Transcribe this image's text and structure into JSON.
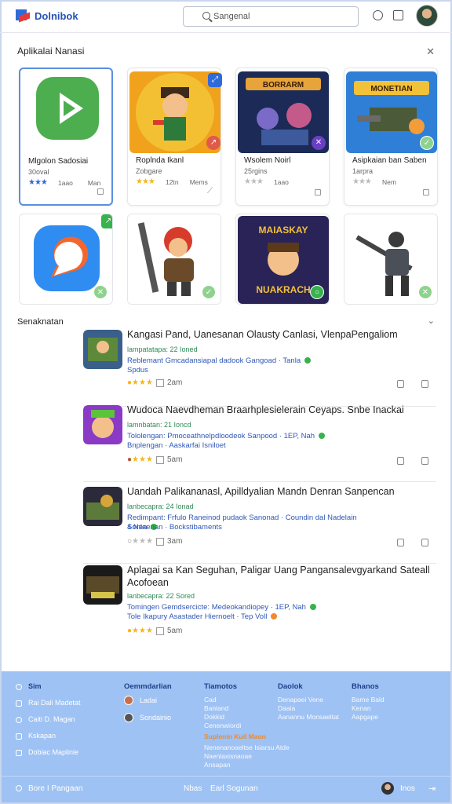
{
  "header": {
    "app_name": "Dolnibok",
    "search_placeholder": "Sangenal"
  },
  "featured": {
    "title": "Aplikalai Nanasi",
    "cards": [
      {
        "title": "Mlgolon Sadosiai",
        "subtitle": "30oval",
        "meta": "1aao",
        "meta2": "Man",
        "stars": "★★★"
      },
      {
        "title": "Roplnda Ikanl",
        "subtitle": "Zobgare",
        "meta": "12tn",
        "meta2": "Mems",
        "stars": "★★★"
      },
      {
        "title": "Wsolem Noirl",
        "subtitle": "25rgins",
        "meta": "1aao",
        "meta2": "",
        "stars": "★★★"
      },
      {
        "title": "Asipkaian ban Saben",
        "subtitle": "1arpra",
        "meta": "Nem",
        "meta2": "",
        "stars": "★★★"
      }
    ],
    "thumb_texts": [
      "BORRARM",
      "MONETIAN",
      "MAIASKAY",
      "NUAKRACH"
    ]
  },
  "recommend": {
    "title": "Senaknatan",
    "rows": [
      {
        "title": "Kangasi Pand, Uanesanan Olausty Canlasi, VlenpaPengaliom",
        "meta": "lampatatapa: 22 Ioned",
        "desc1": "Reblemant Gmcadansiapal dadook Gangoad · Tanla",
        "desc2": "Spdus",
        "time": "2am"
      },
      {
        "title": "Wudoca Naevdheman Braarhplesielerain Ceyaps. Snbe Inackai",
        "meta": "lamnbatan: 21 Ioncd",
        "desc1": "Tololengan: Pmoceathnelpdloodeok Sanpood · 1EP, Nah",
        "desc2": "Bnplengan · Aaskarfai Isniloet",
        "time": "5am"
      },
      {
        "title": "Uandah Palikananasl, Apilldyalian Mandn Denran Sanpencan",
        "meta": "lanbecapra: 24 Ionad",
        "desc1": "Redimpant: Frfulo Raneinod pudaok Sanonad · Coundin dal Nadelain 4 Nen",
        "desc2": "Sonlaenan · Bockstibaments",
        "time": "3am"
      },
      {
        "title": "Aplagai sa Kan Seguhan, Paligar Uang Pangansalevgyarkand Sateall Acofoean",
        "meta": "lanbecapra: 22 Sored",
        "desc1": "Tomingen Gemdsercicte: Medeokandiopey · 1EP, Nah",
        "desc2": "Tole Ikapury Asastader Hiernoelt · Tep Voll",
        "time": "5am"
      }
    ]
  },
  "footer": {
    "col1": [
      "Sim",
      "Rai Dali Madetat",
      "Caiti D. Magan",
      "Kskapan",
      "Dobiac Maplinie"
    ],
    "col2_title": "Oemmdarlian",
    "col2": [
      "Ladai",
      "Sondainio"
    ],
    "col3_title": "Tiamotos",
    "col3": [
      "Cad",
      "Banland",
      "Dokkid",
      "Cenenwiordi"
    ],
    "col3_hot": "Suplenin Kuil Maon",
    "col3_more": [
      "Nenenanoaeltse Isiarsu Atde",
      "Naenlaxisnaoae",
      "Ansapan"
    ],
    "col4_title": "Daolok",
    "col4": [
      "Denapaei Vene",
      "Daaia",
      "Aanannu Monsaeltat"
    ],
    "col5_title": "Bhanos",
    "col5": [
      "Bame Bald",
      "Kenan",
      "Aapgape"
    ],
    "bottom_left": "Bore I Pangaan",
    "bottom_mid1": "Nbas",
    "bottom_mid2": "Earl Sogunan",
    "bottom_right": "Inos"
  },
  "colors": {
    "accent": "#2653b4",
    "footer_bg": "#9ec2f3",
    "star": "#f2b61f",
    "star_blue": "#2f6bd8"
  }
}
